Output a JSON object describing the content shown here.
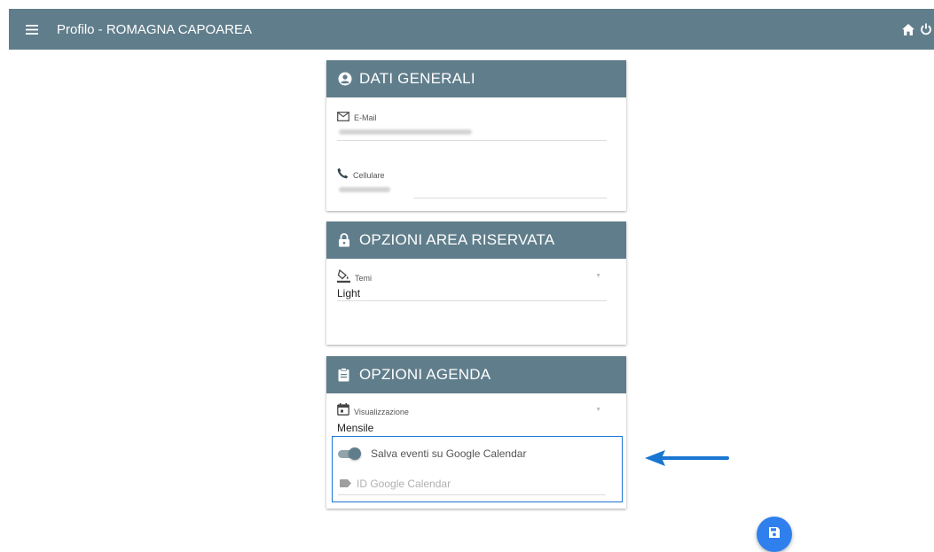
{
  "topbar": {
    "title": "Profilo - ROMAGNA CAPOAREA",
    "menu_icon": "hamburger-menu-icon",
    "home_icon": "home-icon",
    "power_icon": "power-icon",
    "color": "#607d8b"
  },
  "cards": {
    "general": {
      "title": "DATI GENERALI",
      "email_label": "E-Mail",
      "phone_label": "Cellulare"
    },
    "reserved": {
      "title": "OPZIONI AREA RISERVATA",
      "theme_label": "Temi",
      "theme_value": "Light"
    },
    "agenda": {
      "title": "OPZIONI AGENDA",
      "view_label": "Visualizzazione",
      "view_value": "Mensile",
      "gcal_toggle_label": "Salva eventi su Google Calendar",
      "gcal_toggle_on": true,
      "gcal_id_placeholder": "ID Google Calendar"
    }
  },
  "fab": {
    "icon": "save-icon",
    "color": "#2f80ed"
  },
  "highlight_color": "#1976d2"
}
